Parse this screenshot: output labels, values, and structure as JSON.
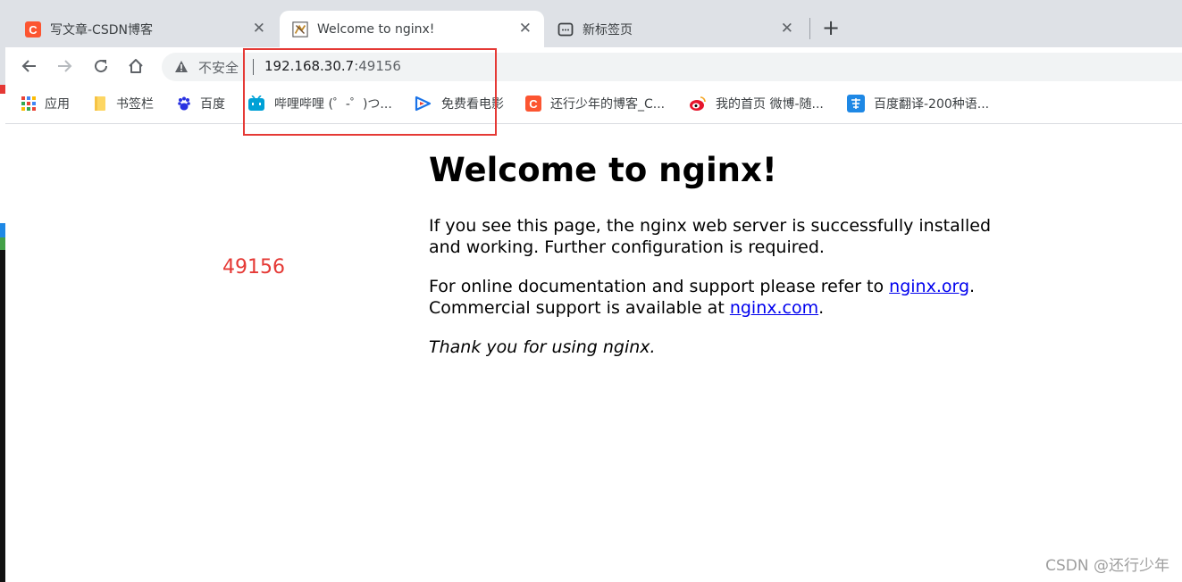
{
  "browser": {
    "tabs": [
      {
        "title": "写文章-CSDN博客",
        "icon": "csdn-icon",
        "active": false
      },
      {
        "title": "Welcome to nginx!",
        "icon": "nginx-icon",
        "active": true
      },
      {
        "title": "新标签页",
        "icon": "newtab-icon",
        "active": false
      }
    ],
    "new_tab_label": "+",
    "close_glyph": "✕",
    "address": {
      "security_label": "不安全",
      "host": "192.168.30.7",
      "port_suffix": ":49156"
    },
    "bookmarks": [
      {
        "label": "应用",
        "icon": "apps-grid-icon"
      },
      {
        "label": "书签栏",
        "icon": "folder-icon"
      },
      {
        "label": "百度",
        "icon": "baidu-paw-icon"
      },
      {
        "label": "哔哩哔哩 (゜-゜)つ...",
        "icon": "bilibili-tv-icon"
      },
      {
        "label": "免费看电影",
        "icon": "video-play-icon"
      },
      {
        "label": "还行少年的博客_C...",
        "icon": "csdn-icon"
      },
      {
        "label": "我的首页 微博-随...",
        "icon": "weibo-icon"
      },
      {
        "label": "百度翻译-200种语...",
        "icon": "translate-icon"
      }
    ]
  },
  "page": {
    "heading": "Welcome to nginx!",
    "para1": "If you see this page, the nginx web server is successfully installed and working. Further configuration is required.",
    "para2_prefix": "For online documentation and support please refer to ",
    "link1": "nginx.org",
    "para2_middle": ".",
    "para2_line2_prefix": "Commercial support is available at ",
    "link2": "nginx.com",
    "para2_end": ".",
    "thanks": "Thank you for using nginx."
  },
  "annotation": {
    "port_note": "49156",
    "color": "#e53935"
  },
  "watermark": "CSDN @还行少年"
}
